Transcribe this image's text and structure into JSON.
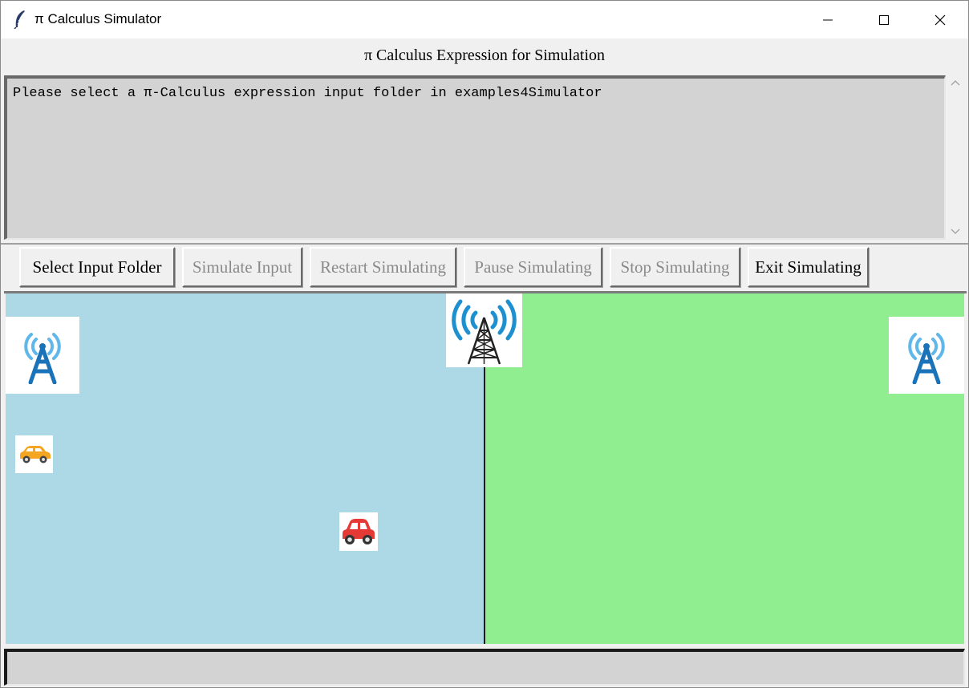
{
  "window": {
    "title": "π Calculus Simulator",
    "icons": {
      "app": "feather-icon",
      "minimize": "minimize-icon",
      "maximize": "maximize-icon",
      "close": "close-icon"
    }
  },
  "header": {
    "label": "π Calculus Expression for Simulation"
  },
  "expression": {
    "text": "Please select a π-Calculus expression input folder in examples4Simulator"
  },
  "toolbar": {
    "buttons": [
      {
        "label": "Select Input Folder",
        "enabled": true
      },
      {
        "label": "Simulate Input",
        "enabled": false
      },
      {
        "label": "Restart Simulating",
        "enabled": false
      },
      {
        "label": "Pause Simulating",
        "enabled": false
      },
      {
        "label": "Stop Simulating",
        "enabled": false
      },
      {
        "label": "Exit Simulating",
        "enabled": true
      }
    ]
  },
  "simulation": {
    "zones": [
      {
        "name": "left-zone",
        "color": "#add8e6"
      },
      {
        "name": "right-zone",
        "color": "#90ee90"
      }
    ],
    "towers": [
      {
        "name": "left-tower",
        "icon": "cell-tower-icon",
        "color": "#1a73b8"
      },
      {
        "name": "center-tower",
        "icon": "radio-tower-icon",
        "color": "#1e90d0"
      },
      {
        "name": "right-tower",
        "icon": "cell-tower-icon",
        "color": "#1a73b8"
      }
    ],
    "vehicles": [
      {
        "name": "orange-car",
        "icon": "car-icon",
        "color": "#f4a521"
      },
      {
        "name": "red-car",
        "icon": "car-icon",
        "color": "#e53935"
      }
    ]
  },
  "status_bar": {
    "text": ""
  }
}
